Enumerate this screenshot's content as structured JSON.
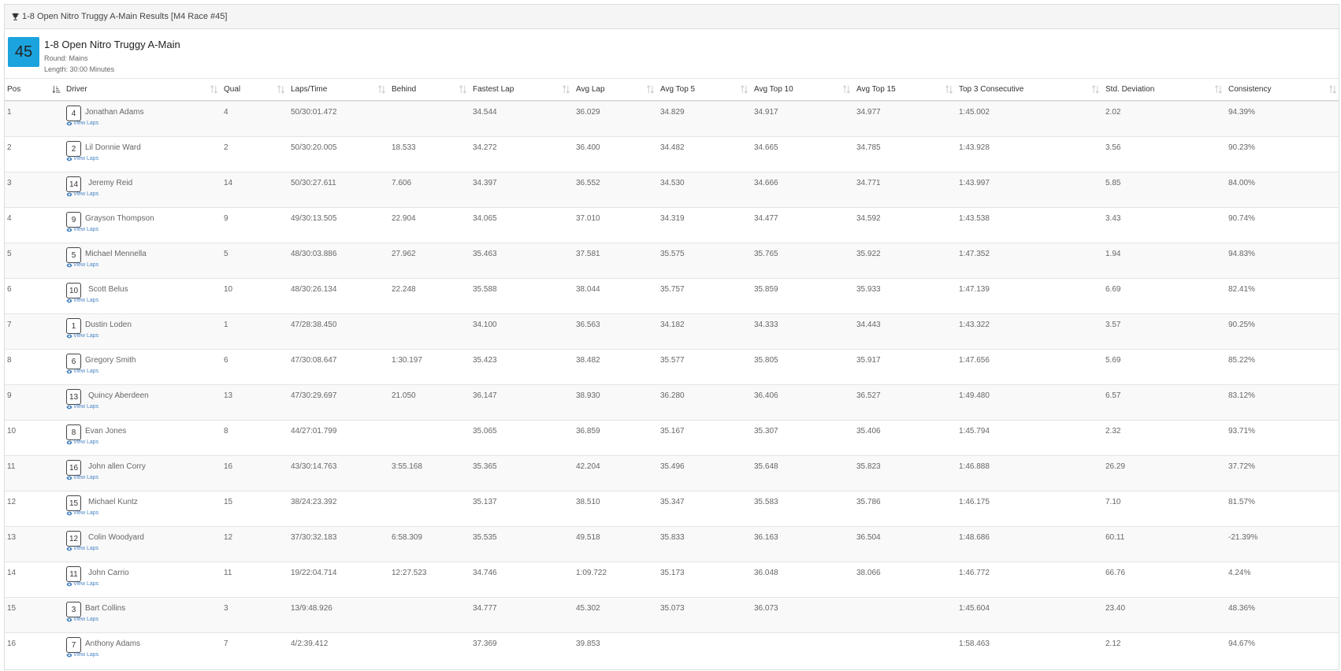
{
  "panel": {
    "heading": "1-8 Open Nitro Truggy A-Main Results [M4 Race #45]",
    "icon": "trophy-icon"
  },
  "race": {
    "number": "45",
    "title": "1-8 Open Nitro Truggy A-Main",
    "round": "Round: Mains",
    "length": "Length: 30:00 Minutes",
    "badge_color": "#1ba3dd"
  },
  "table": {
    "columns": [
      "Pos",
      "Driver",
      "Qual",
      "Laps/Time",
      "Behind",
      "Fastest Lap",
      "Avg Lap",
      "Avg Top 5",
      "Avg Top 10",
      "Avg Top 15",
      "Top 3 Consecutive",
      "Std. Deviation",
      "Consistency"
    ],
    "view_laps_label": "View Laps",
    "rows": [
      {
        "pos": "1",
        "car": "4",
        "driver": "Jonathan Adams",
        "qual": "4",
        "laps": "50/30:01.472",
        "behind": "",
        "fastest": "34.544",
        "avg": "36.029",
        "top5": "34.829",
        "top10": "34.917",
        "top15": "34.977",
        "top3c": "1:45.002",
        "std": "2.02",
        "cons": "94.39%"
      },
      {
        "pos": "2",
        "car": "2",
        "driver": "Lil Donnie Ward",
        "qual": "2",
        "laps": "50/30:20.005",
        "behind": "18.533",
        "fastest": "34.272",
        "avg": "36.400",
        "top5": "34.482",
        "top10": "34.665",
        "top15": "34.785",
        "top3c": "1:43.928",
        "std": "3.56",
        "cons": "90.23%"
      },
      {
        "pos": "3",
        "car": "14",
        "driver": "Jeremy Reid",
        "qual": "14",
        "laps": "50/30:27.611",
        "behind": "7.606",
        "fastest": "34.397",
        "avg": "36.552",
        "top5": "34.530",
        "top10": "34.666",
        "top15": "34.771",
        "top3c": "1:43.997",
        "std": "5.85",
        "cons": "84.00%"
      },
      {
        "pos": "4",
        "car": "9",
        "driver": "Grayson Thompson",
        "qual": "9",
        "laps": "49/30:13.505",
        "behind": "22.904",
        "fastest": "34.065",
        "avg": "37.010",
        "top5": "34.319",
        "top10": "34.477",
        "top15": "34.592",
        "top3c": "1:43.538",
        "std": "3.43",
        "cons": "90.74%"
      },
      {
        "pos": "5",
        "car": "5",
        "driver": "Michael Mennella",
        "qual": "5",
        "laps": "48/30:03.886",
        "behind": "27.962",
        "fastest": "35.463",
        "avg": "37.581",
        "top5": "35.575",
        "top10": "35.765",
        "top15": "35.922",
        "top3c": "1:47.352",
        "std": "1.94",
        "cons": "94.83%"
      },
      {
        "pos": "6",
        "car": "10",
        "driver": "Scott Belus",
        "qual": "10",
        "laps": "48/30:26.134",
        "behind": "22.248",
        "fastest": "35.588",
        "avg": "38.044",
        "top5": "35.757",
        "top10": "35.859",
        "top15": "35.933",
        "top3c": "1:47.139",
        "std": "6.69",
        "cons": "82.41%"
      },
      {
        "pos": "7",
        "car": "1",
        "driver": "Dustin Loden",
        "qual": "1",
        "laps": "47/28:38.450",
        "behind": "",
        "fastest": "34.100",
        "avg": "36.563",
        "top5": "34.182",
        "top10": "34.333",
        "top15": "34.443",
        "top3c": "1:43.322",
        "std": "3.57",
        "cons": "90.25%"
      },
      {
        "pos": "8",
        "car": "6",
        "driver": "Gregory Smith",
        "qual": "6",
        "laps": "47/30:08.647",
        "behind": "1:30.197",
        "fastest": "35.423",
        "avg": "38.482",
        "top5": "35.577",
        "top10": "35.805",
        "top15": "35.917",
        "top3c": "1:47.656",
        "std": "5.69",
        "cons": "85.22%"
      },
      {
        "pos": "9",
        "car": "13",
        "driver": "Quincy Aberdeen",
        "qual": "13",
        "laps": "47/30:29.697",
        "behind": "21.050",
        "fastest": "36.147",
        "avg": "38.930",
        "top5": "36.280",
        "top10": "36.406",
        "top15": "36.527",
        "top3c": "1:49.480",
        "std": "6.57",
        "cons": "83.12%"
      },
      {
        "pos": "10",
        "car": "8",
        "driver": "Evan Jones",
        "qual": "8",
        "laps": "44/27:01.799",
        "behind": "",
        "fastest": "35.065",
        "avg": "36.859",
        "top5": "35.167",
        "top10": "35.307",
        "top15": "35.406",
        "top3c": "1:45.794",
        "std": "2.32",
        "cons": "93.71%"
      },
      {
        "pos": "11",
        "car": "16",
        "driver": "John allen Corry",
        "qual": "16",
        "laps": "43/30:14.763",
        "behind": "3:55.168",
        "fastest": "35.365",
        "avg": "42.204",
        "top5": "35.496",
        "top10": "35.648",
        "top15": "35.823",
        "top3c": "1:46.888",
        "std": "26.29",
        "cons": "37.72%"
      },
      {
        "pos": "12",
        "car": "15",
        "driver": "Michael Kuntz",
        "qual": "15",
        "laps": "38/24:23.392",
        "behind": "",
        "fastest": "35.137",
        "avg": "38.510",
        "top5": "35.347",
        "top10": "35.583",
        "top15": "35.786",
        "top3c": "1:46.175",
        "std": "7.10",
        "cons": "81.57%"
      },
      {
        "pos": "13",
        "car": "12",
        "driver": "Colin Woodyard",
        "qual": "12",
        "laps": "37/30:32.183",
        "behind": "6:58.309",
        "fastest": "35.535",
        "avg": "49.518",
        "top5": "35.833",
        "top10": "36.163",
        "top15": "36.504",
        "top3c": "1:48.686",
        "std": "60.11",
        "cons": "-21.39%"
      },
      {
        "pos": "14",
        "car": "11",
        "driver": "John Carrio",
        "qual": "11",
        "laps": "19/22:04.714",
        "behind": "12:27.523",
        "fastest": "34.746",
        "avg": "1:09.722",
        "top5": "35.173",
        "top10": "36.048",
        "top15": "38.066",
        "top3c": "1:46.772",
        "std": "66.76",
        "cons": "4.24%"
      },
      {
        "pos": "15",
        "car": "3",
        "driver": "Bart Collins",
        "qual": "3",
        "laps": "13/9:48.926",
        "behind": "",
        "fastest": "34.777",
        "avg": "45.302",
        "top5": "35.073",
        "top10": "36.073",
        "top15": "",
        "top3c": "1:45.604",
        "std": "23.40",
        "cons": "48.36%"
      },
      {
        "pos": "16",
        "car": "7",
        "driver": "Anthony Adams",
        "qual": "7",
        "laps": "4/2:39.412",
        "behind": "",
        "fastest": "37.369",
        "avg": "39.853",
        "top5": "",
        "top10": "",
        "top15": "",
        "top3c": "1:58.463",
        "std": "2.12",
        "cons": "94.67%"
      }
    ]
  }
}
